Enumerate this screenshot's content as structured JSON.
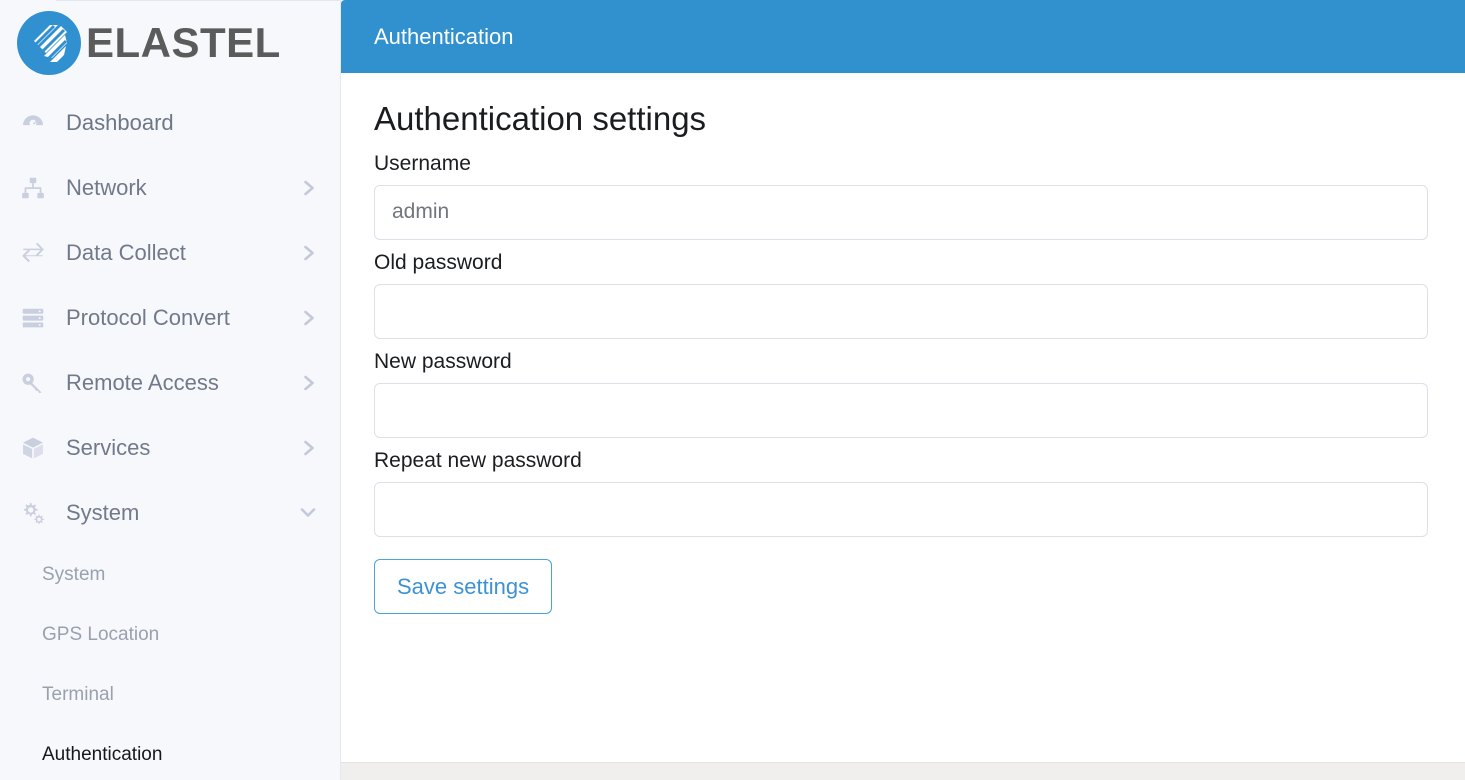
{
  "brand": {
    "name": "ELASTEL",
    "logo_icon": "elastel-circle-logo",
    "logo_color": "#3191d0",
    "text_color": "#5b5b5b"
  },
  "sidebar": {
    "items": [
      {
        "label": "Dashboard",
        "icon": "dashboard-icon",
        "chevron": "",
        "expandable": false
      },
      {
        "label": "Network",
        "icon": "sitemap-icon",
        "chevron": "chevron-right-icon",
        "expandable": true
      },
      {
        "label": "Data Collect",
        "icon": "exchange-arrows-icon",
        "chevron": "chevron-right-icon",
        "expandable": true
      },
      {
        "label": "Protocol Convert",
        "icon": "server-icon",
        "chevron": "chevron-right-icon",
        "expandable": true
      },
      {
        "label": "Remote Access",
        "icon": "key-icon",
        "chevron": "chevron-right-icon",
        "expandable": true
      },
      {
        "label": "Services",
        "icon": "cube-icon",
        "chevron": "chevron-right-icon",
        "expandable": true
      },
      {
        "label": "System",
        "icon": "cogs-icon",
        "chevron": "chevron-down-icon",
        "expandable": true
      }
    ],
    "subitems": [
      {
        "label": "System",
        "active": false
      },
      {
        "label": "GPS Location",
        "active": false
      },
      {
        "label": "Terminal",
        "active": false
      },
      {
        "label": "Authentication",
        "active": true
      }
    ]
  },
  "header": {
    "title": "Authentication",
    "background": "#3091ce",
    "text_color": "#ffffff"
  },
  "form": {
    "title": "Authentication settings",
    "fields": [
      {
        "label": "Username",
        "value": "",
        "placeholder": "admin",
        "type": "text"
      },
      {
        "label": "Old password",
        "value": "",
        "placeholder": "",
        "type": "password"
      },
      {
        "label": "New password",
        "value": "",
        "placeholder": "",
        "type": "password"
      },
      {
        "label": "Repeat new password",
        "value": "",
        "placeholder": "",
        "type": "password"
      }
    ],
    "save_label": "Save settings",
    "accent_color": "#3d92d4"
  }
}
